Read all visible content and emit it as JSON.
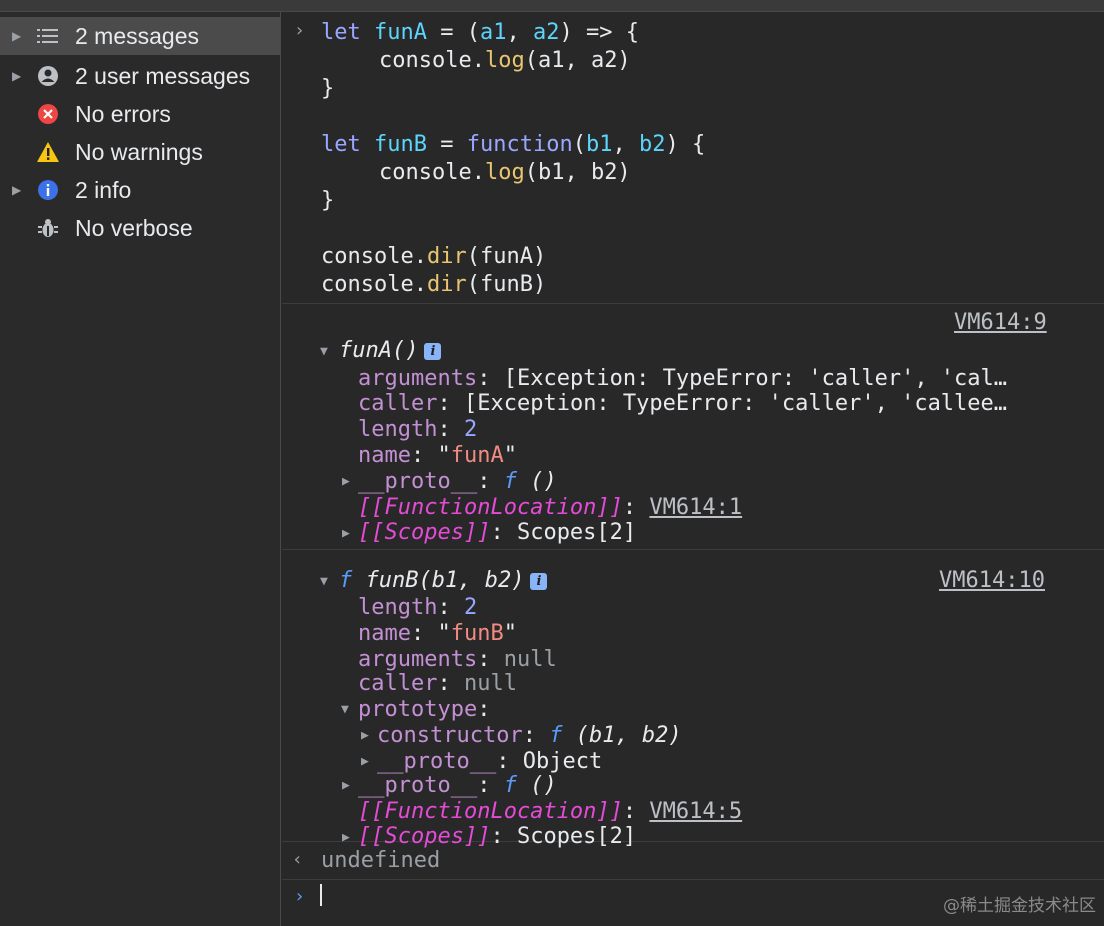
{
  "sidebar": {
    "items": [
      {
        "label": "2 messages",
        "icon": "list-icon",
        "expandable": true,
        "selected": true
      },
      {
        "label": "2 user messages",
        "icon": "user-icon",
        "expandable": true
      },
      {
        "label": "No errors",
        "icon": "error-icon",
        "expandable": false
      },
      {
        "label": "No warnings",
        "icon": "warning-icon",
        "expandable": false
      },
      {
        "label": "2 info",
        "icon": "info-icon",
        "expandable": true
      },
      {
        "label": "No verbose",
        "icon": "bug-icon",
        "expandable": false
      }
    ]
  },
  "input_code": {
    "l1": {
      "kw": "let",
      "name": "funA",
      "op": " = (",
      "p1": "a1",
      "sep": ", ",
      "p2": "a2",
      "arrow": ") => {"
    },
    "l2": {
      "obj": "console.",
      "method": "log",
      "args": "(a1, a2)"
    },
    "l3": "}",
    "l4": {
      "kw": "let",
      "name": "funB",
      "op": " = ",
      "fnkw": "function",
      "open": "(",
      "p1": "b1",
      "sep": ", ",
      "p2": "b2",
      "close": ") {"
    },
    "l5": {
      "obj": "console.",
      "method": "log",
      "args": "(b1, b2)"
    },
    "l6": "}",
    "l7": {
      "obj": "console.",
      "method": "dir",
      "args": "(funA)"
    },
    "l8": {
      "obj": "console.",
      "method": "dir",
      "args": "(funB)"
    }
  },
  "output_a": {
    "source": "VM614:9",
    "header": "funA()",
    "info_badge": "i",
    "arguments_key": "arguments",
    "arguments_val": "[Exception: TypeError: 'caller', 'cal…",
    "caller_key": "caller",
    "caller_val": "[Exception: TypeError: 'caller', 'callee…",
    "length_key": "length",
    "length_val": "2",
    "name_key": "name",
    "name_q1": "\"",
    "name_val": "funA",
    "name_q2": "\"",
    "proto_key": "__proto__",
    "proto_f": "f",
    "proto_val": "()",
    "loc_key": "[[FunctionLocation]]",
    "loc_val": "VM614:1",
    "scopes_key": "[[Scopes]]",
    "scopes_val": "Scopes[2]"
  },
  "output_b": {
    "source": "VM614:10",
    "header_f": "f",
    "header": "funB(b1, b2)",
    "info_badge": "i",
    "length_key": "length",
    "length_val": "2",
    "name_key": "name",
    "name_q1": "\"",
    "name_val": "funB",
    "name_q2": "\"",
    "arguments_key": "arguments",
    "arguments_val": "null",
    "caller_key": "caller",
    "caller_val": "null",
    "prototype_key": "prototype",
    "constructor_key": "constructor",
    "constructor_f": "f",
    "constructor_val": "(b1, b2)",
    "proto2_key": "__proto__",
    "proto2_val": "Object",
    "proto_key": "__proto__",
    "proto_f": "f",
    "proto_val": "()",
    "loc_key": "[[FunctionLocation]]",
    "loc_val": "VM614:5",
    "scopes_key": "[[Scopes]]",
    "scopes_val": "Scopes[2]"
  },
  "result": "undefined",
  "watermark": "@稀土掘金技术社区"
}
